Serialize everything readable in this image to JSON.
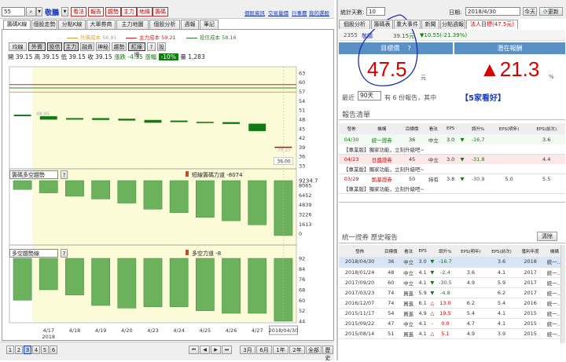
{
  "toolbar": {
    "code": "55",
    "stock_name": "敬鵬",
    "tool_buttons": [
      "看法",
      "報告",
      "趨勢",
      "主力",
      "地緣",
      "籌碼"
    ],
    "links": [
      "個股資訊",
      "交易量價",
      "行事曆",
      "我的選股"
    ]
  },
  "chart_tabs": [
    "籌碼K線",
    "個股走勢",
    "分點K線",
    "大單券商",
    "主力地圖",
    "個股分析",
    "週報",
    "筆記"
  ],
  "legend": [
    {
      "label": "外資成本 56.81",
      "color": "#e0a030"
    },
    {
      "label": "主力成本 59.21",
      "color": "#d22020"
    },
    {
      "label": "投信成本 58.16",
      "color": "#2f7f2f"
    }
  ],
  "indicator_buttons": [
    "均線",
    "外資",
    "投信",
    "主力",
    "融資",
    "神秘",
    "趨勢",
    "紅綠燈",
    "?",
    "設"
  ],
  "price_info": {
    "open": "開 39.15",
    "high": "高 39.15",
    "low": "低 39.15",
    "close": "收 39.15",
    "change": "漲跌 -4.35",
    "pct_label": "漲幅",
    "pct": "-10%",
    "volume": "量 1,283"
  },
  "price_axis": [
    "63",
    "60",
    "57",
    "54",
    "51",
    "48",
    "45",
    "42",
    "39",
    "36",
    "33"
  ],
  "chip_axis": [
    "9234.7",
    "8065",
    "6452",
    "4839",
    "3226",
    "1613",
    "0"
  ],
  "trend_axis": [
    "92",
    "84",
    "76",
    "68",
    "60",
    "52",
    "44"
  ],
  "annot": {
    "label1": "48.95",
    "label2": "39.15",
    "label3": "36.00"
  },
  "panel2": {
    "select": "籌碼多空趨勢",
    "title": "短線籌碼力道 -8074"
  },
  "panel3": {
    "select": "多空趨勢線",
    "title": "多空力道 -8"
  },
  "x_dates": [
    "4/17",
    "4/18",
    "4/19",
    "4/20",
    "4/23",
    "4/24",
    "4/25",
    "4/26",
    "4/27"
  ],
  "x_year": "2018",
  "x_current": "2018/04/30",
  "bottom_bar": {
    "pages": [
      "1",
      "2",
      "3",
      "4",
      "5",
      "6"
    ],
    "active_page": "3",
    "ranges": [
      "3月",
      "6月",
      "1年",
      "2年",
      "全部"
    ],
    "today": "歷史"
  },
  "chart_data": [
    {
      "type": "candlestick",
      "x": [
        "4/16",
        "4/17",
        "4/18",
        "4/19",
        "4/20",
        "4/23",
        "4/24",
        "4/25",
        "4/26",
        "4/27",
        "4/30"
      ],
      "open": [
        49.5,
        49.0,
        48.4,
        48.4,
        48.2,
        47.8,
        47.6,
        47.2,
        47.1,
        46.6,
        39.15
      ],
      "close": [
        49.0,
        47.9,
        47.9,
        47.8,
        47.6,
        46.9,
        47.1,
        46.8,
        46.5,
        44.2,
        39.15
      ],
      "lines": [
        {
          "name": "外資成本",
          "value": 56.81
        },
        {
          "name": "主力成本",
          "value": 59.21
        },
        {
          "name": "投信成本",
          "value": 58.16
        }
      ],
      "ylim": [
        32,
        65
      ]
    },
    {
      "type": "bar",
      "title": "短線籌碼力道",
      "x": [
        "4/16",
        "4/17",
        "4/18",
        "4/19",
        "4/20",
        "4/23",
        "4/24",
        "4/25",
        "4/26",
        "4/27",
        "4/30"
      ],
      "values": [
        -1300,
        -1800,
        -2300,
        -2700,
        -3300,
        -4200,
        -4700,
        -5400,
        -5900,
        -6500,
        -8074
      ],
      "ylim": [
        -9234.7,
        0
      ]
    },
    {
      "type": "bar",
      "title": "多空力道",
      "x": [
        "4/16",
        "4/17",
        "4/18",
        "4/19",
        "4/20",
        "4/23",
        "4/24",
        "4/25",
        "4/26",
        "4/27",
        "4/30"
      ],
      "values": [
        60,
        68,
        64,
        56,
        54,
        55,
        55,
        52,
        50,
        50,
        44
      ],
      "ylim": [
        44,
        92
      ]
    }
  ],
  "right_header": {
    "stats_label": "統計天數:",
    "stats_value": "10",
    "date_label": "日期:",
    "date_value": "2018/4/30",
    "today_btn": "今天",
    "refresh_btn": "更新"
  },
  "right_tabs": [
    "個股分析",
    "籌碼表",
    "重大事件",
    "新聞",
    "分點週報",
    "法人目標(47.5元)"
  ],
  "quote": {
    "code": "2355",
    "name": "敬鵬",
    "price": "39.15元",
    "change": "▼10.55(-21.39%)"
  },
  "target": {
    "label": "目標價",
    "help": "?",
    "value": "47.5",
    "unit": "元",
    "potential_label": "潛在報酬",
    "potential": "▲21.3",
    "potential_unit": "%"
  },
  "recent": {
    "prefix": "最近",
    "days": "90天",
    "mid": "有 6 份報告，其中",
    "highlight": "【5家看好】"
  },
  "report_list": {
    "title": "報告清單",
    "headers": [
      "發佈",
      "機構",
      "目標價",
      "看法",
      "EPS",
      "",
      "調升%",
      "EPS(明年)",
      "EPS(前次)"
    ],
    "rows": [
      {
        "date": "04/30",
        "org": "統一證券",
        "target": "36",
        "view": "中立",
        "eps": "3.0",
        "arrow": "▼",
        "pct": "-16.7",
        "eps_next": "",
        "eps_prev": "3.6",
        "note": "【專業版】獨家功能，立刻升級吧~"
      },
      {
        "date": "04/23",
        "org": "日盛證券",
        "target": "45",
        "view": "中立",
        "eps": "3.0",
        "arrow": "▼",
        "pct": "-31.8",
        "eps_next": "",
        "eps_prev": "4.4",
        "note": "【專業版】獨家功能，立刻升級吧~"
      },
      {
        "date": "03/29",
        "org": "凱基證券",
        "target": "50",
        "view": "持有",
        "eps": "3.8",
        "arrow": "▼",
        "pct": "-30.9",
        "eps_next": "5.0",
        "eps_prev": "5.5",
        "note": "【專業版】獨家功能，立刻升級吧~"
      }
    ]
  },
  "history": {
    "title": "統一證券 歷史報告",
    "clear_btn": "清除",
    "headers": [
      "發佈",
      "目標價",
      "看法",
      "EPS",
      "",
      "調升%",
      "EPS(明年)",
      "EPS(前次)",
      "獲利年度",
      "機構"
    ],
    "rows": [
      [
        "2018/04/30",
        "36",
        "中立",
        "3.0",
        "▼",
        "-16.7",
        "",
        "3.6",
        "2018",
        "統一..."
      ],
      [
        "2018/01/24",
        "48",
        "中立",
        "4.1",
        "▼",
        "-2.4",
        "3.6",
        "4.1",
        "2017",
        "統一..."
      ],
      [
        "2017/09/20",
        "60",
        "中立",
        "4.1",
        "▼",
        "-30.5",
        "4.9",
        "5.9",
        "2017",
        "統一..."
      ],
      [
        "2017/03/23",
        "74",
        "買進",
        "5.9",
        "▼",
        "-4.8",
        "",
        "6.2",
        "2017",
        "統一..."
      ],
      [
        "2016/12/07",
        "74",
        "買進",
        "6.1",
        "△",
        "13.0",
        "6.2",
        "5.4",
        "2016",
        "統一..."
      ],
      [
        "2015/11/17",
        "54",
        "買進",
        "4.9",
        "△",
        "19.5",
        "5.4",
        "4.1",
        "2015",
        "統一..."
      ],
      [
        "2015/09/22",
        "47",
        "中立",
        "4.1",
        "-",
        "0.0",
        "4.7",
        "4.1",
        "2015",
        "統一..."
      ],
      [
        "2015/08/14",
        "51",
        "買進",
        "4.1",
        "△",
        "5.1",
        "4.9",
        "3.9",
        "2015",
        "統一..."
      ]
    ]
  },
  "colors": {
    "up": "#d80000",
    "down": "#117a11",
    "link": "#1a3bb5",
    "highlight": "#fbfbd8"
  }
}
